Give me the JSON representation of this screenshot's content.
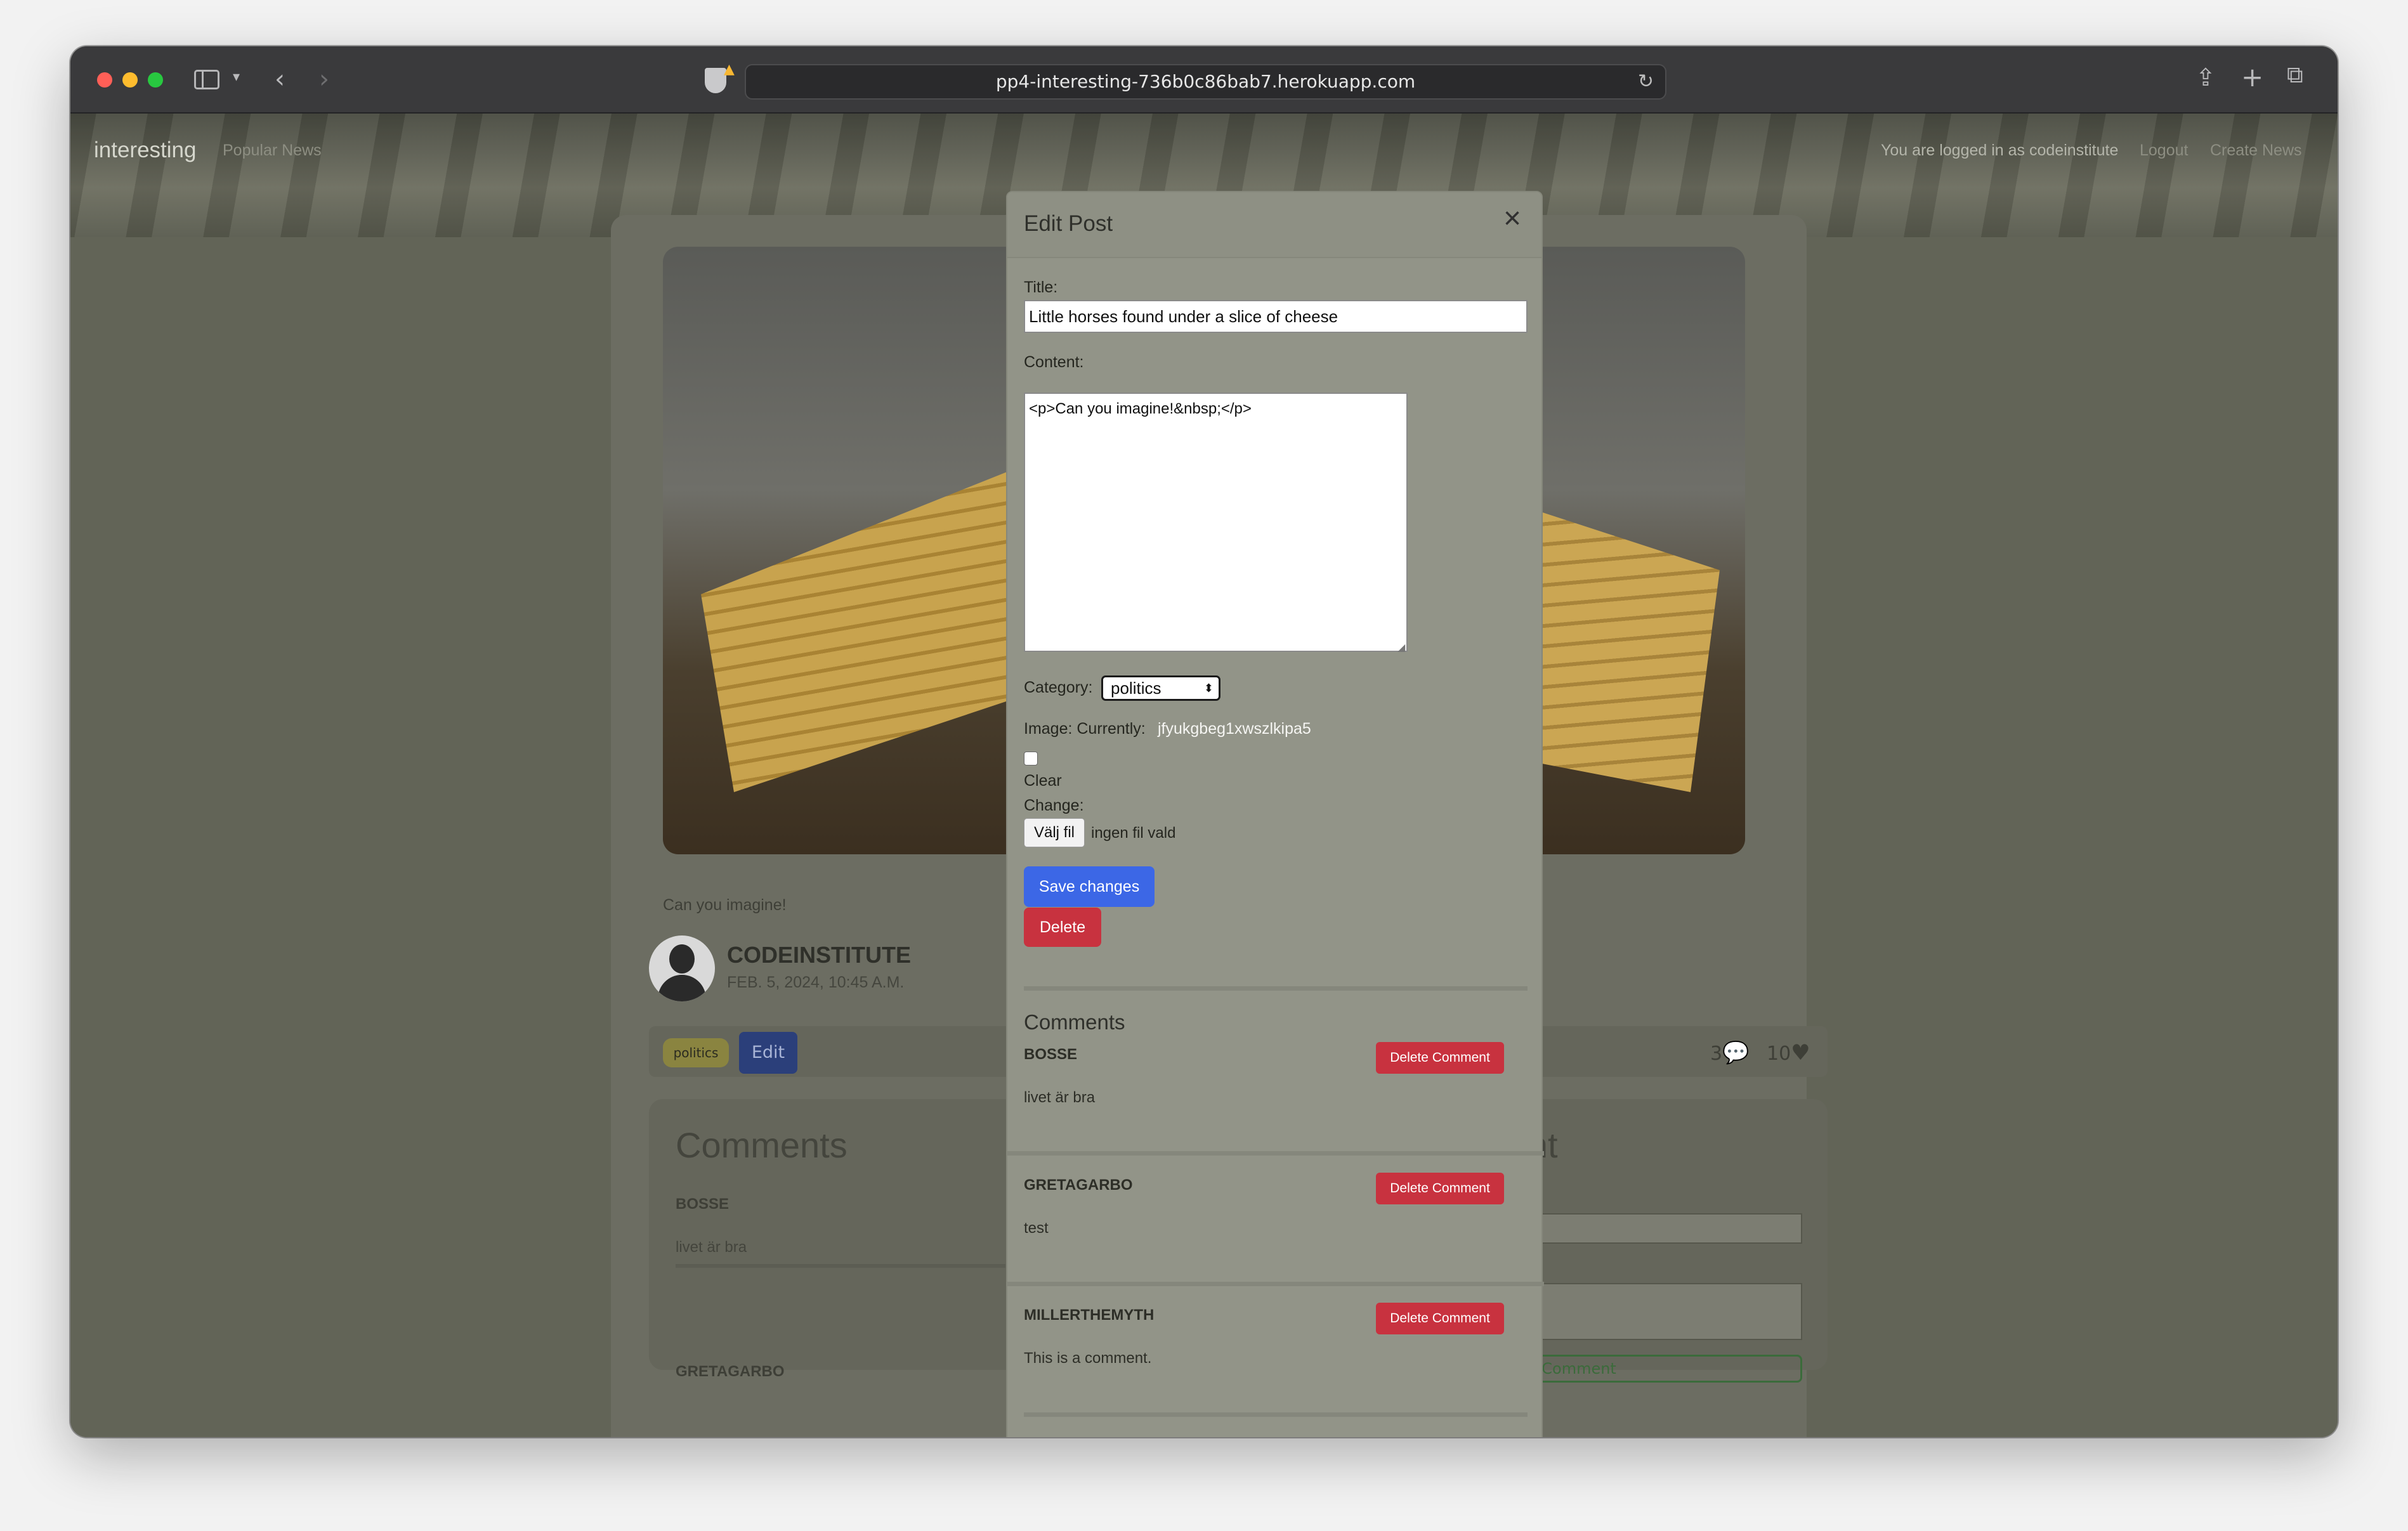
{
  "browser": {
    "url": "pp4-interesting-736b0c86bab7.herokuapp.com",
    "icons": [
      "sidebar-icon",
      "chevron-down-icon",
      "back-arrow-icon",
      "forward-arrow-icon",
      "shield-icon",
      "reload-icon",
      "share-icon",
      "new-tab-plus-icon",
      "tabs-overview-icon"
    ]
  },
  "navbar": {
    "brand": "interesting",
    "popular": "Popular News",
    "logged_in_text": "You are logged in as codeinstitute",
    "logout": "Logout",
    "create": "Create News"
  },
  "post": {
    "excerpt": "Can you imagine!",
    "author": "CODEINSTITUTE",
    "date": "FEB. 5, 2024, 10:45 A.M.",
    "category_tag": "politics",
    "edit_label": "Edit",
    "comment_count": "3",
    "like_count": "10"
  },
  "background_comments": {
    "title": "Comments",
    "items": [
      {
        "author": "BOSSE",
        "text": "livet är bra"
      },
      {
        "author": "GRETAGARBO",
        "text": "test"
      }
    ],
    "add_title": "ment",
    "add_button": "Add Comment"
  },
  "modal": {
    "title": "Edit Post",
    "title_label": "Title:",
    "title_value": "Little horses found under a slice of cheese",
    "content_label": "Content:",
    "content_value": "<p>Can you imagine!&nbsp;</p>",
    "category_label": "Category:",
    "category_value": "politics",
    "image_label": "Image: Currently:",
    "image_current": "jfyukgbeg1xwszlkipa5",
    "clear_label": "Clear",
    "change_label": "Change:",
    "file_button": "Välj fil",
    "file_status": "ingen fil vald",
    "save_label": "Save changes",
    "delete_label": "Delete",
    "comments_title": "Comments",
    "delete_comment_label": "Delete Comment",
    "comments": [
      {
        "author": "BOSSE",
        "text": "livet är bra"
      },
      {
        "author": "GRETAGARBO",
        "text": "test"
      },
      {
        "author": "MILLERTHEMYTH",
        "text": "This is a comment."
      }
    ]
  },
  "colors": {
    "primary": "#3c67e6",
    "danger": "#c8323f",
    "modal_bg": "#929488",
    "overlay_bg": "#626457"
  }
}
